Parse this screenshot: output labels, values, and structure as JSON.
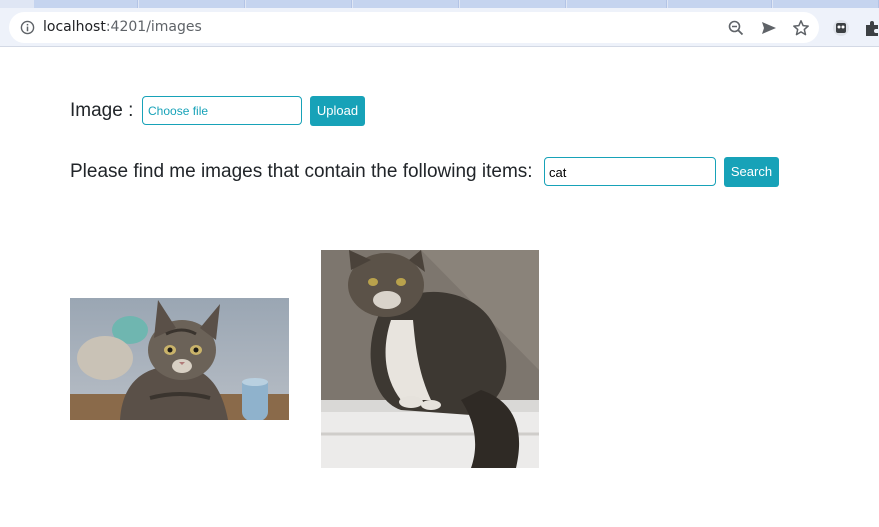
{
  "browser": {
    "url_host": "localhost",
    "url_path": ":4201/images"
  },
  "upload": {
    "label": "Image :",
    "file_placeholder": "Choose file",
    "button_label": "Upload"
  },
  "search": {
    "prompt": "Please find me images that contain the following items:",
    "value": "cat",
    "button_label": "Search"
  },
  "results": {
    "images": [
      {
        "subject": "kitten-photo"
      },
      {
        "subject": "fluffy-cat-photo"
      }
    ]
  },
  "colors": {
    "accent": "#17a2b8",
    "text": "#212529"
  }
}
